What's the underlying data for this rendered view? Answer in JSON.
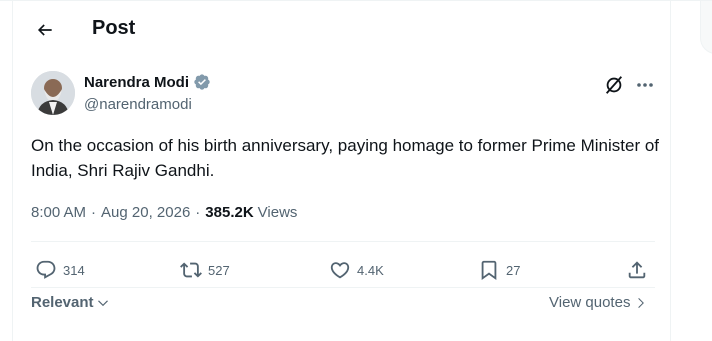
{
  "header": {
    "title": "Post"
  },
  "author": {
    "name": "Narendra Modi",
    "handle": "@narendramodi"
  },
  "post": {
    "text": "On the occasion of his birth anniversary, paying homage to former Prime Minister of India, Shri Rajiv Gandhi.",
    "time": "8:00 AM",
    "separator": "·",
    "date": "Aug 20, 2026",
    "views_count": "385.2K",
    "views_label": "Views"
  },
  "actions": {
    "replies": "314",
    "reposts": "527",
    "likes": "4.4K",
    "bookmarks": "27"
  },
  "replies_sort": {
    "label": "Relevant"
  },
  "view_quotes": {
    "label": "View quotes"
  },
  "colors": {
    "text": "#0f1419",
    "muted": "#536471",
    "verified": "#829aab",
    "border": "#eff3f4"
  },
  "icons": [
    "back-arrow-icon",
    "verified-badge-icon",
    "grok-icon",
    "more-icon",
    "reply-icon",
    "repost-icon",
    "like-icon",
    "bookmark-icon",
    "share-icon",
    "chevron-down-icon",
    "chevron-right-icon"
  ]
}
